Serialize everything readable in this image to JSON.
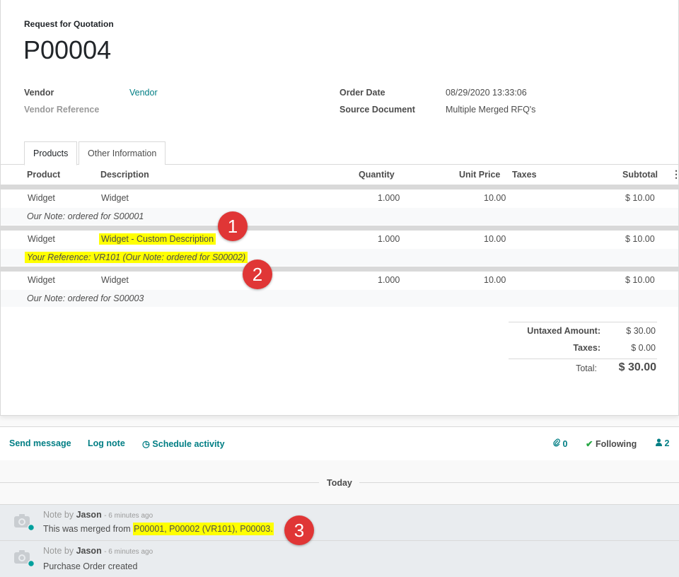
{
  "header": {
    "doc_type": "Request for Quotation",
    "doc_name": "P00004"
  },
  "fields": {
    "vendor_label": "Vendor",
    "vendor_value": "Vendor",
    "vendor_ref_label": "Vendor Reference",
    "order_date_label": "Order Date",
    "order_date_value": "08/29/2020 13:33:06",
    "source_doc_label": "Source Document",
    "source_doc_value": "Multiple Merged RFQ's"
  },
  "tabs": [
    {
      "label": "Products",
      "active": true
    },
    {
      "label": "Other Information",
      "active": false
    }
  ],
  "table": {
    "columns": [
      "Product",
      "Description",
      "Quantity",
      "Unit Price",
      "Taxes",
      "Subtotal"
    ],
    "rows": [
      {
        "product": "Widget",
        "description": "Widget",
        "quantity": "1.000",
        "unit_price": "10.00",
        "taxes": "",
        "subtotal": "$ 10.00",
        "note": "Our Note: ordered for S00001"
      },
      {
        "product": "Widget",
        "description": "Widget - Custom Description",
        "quantity": "1.000",
        "unit_price": "10.00",
        "taxes": "",
        "subtotal": "$ 10.00",
        "note": "Your Reference: VR101 (Our Note: ordered for S00002)"
      },
      {
        "product": "Widget",
        "description": "Widget",
        "quantity": "1.000",
        "unit_price": "10.00",
        "taxes": "",
        "subtotal": "$ 10.00",
        "note": "Our Note: ordered for S00003"
      }
    ]
  },
  "totals": {
    "untaxed_label": "Untaxed Amount:",
    "untaxed_value": "$ 30.00",
    "taxes_label": "Taxes:",
    "taxes_value": "$ 0.00",
    "total_label": "Total:",
    "total_value": "$ 30.00"
  },
  "annotations": [
    "1",
    "2",
    "3"
  ],
  "chatter": {
    "send_message": "Send message",
    "log_note": "Log note",
    "schedule_activity": "Schedule activity",
    "attachments_count": "0",
    "following": "Following",
    "followers_count": "2",
    "today": "Today"
  },
  "messages": [
    {
      "type": "Note by",
      "author": "Jason",
      "time": "- 6 minutes ago",
      "body_prefix": "This was merged from ",
      "body_highlight": "P00001, P00002 (VR101), P00003."
    },
    {
      "type": "Note by",
      "author": "Jason",
      "time": "- 6 minutes ago",
      "body_prefix": "Purchase Order created",
      "body_highlight": ""
    }
  ],
  "colors": {
    "accent": "#017e84",
    "highlight": "#ffff00",
    "badge": "#e03636"
  }
}
